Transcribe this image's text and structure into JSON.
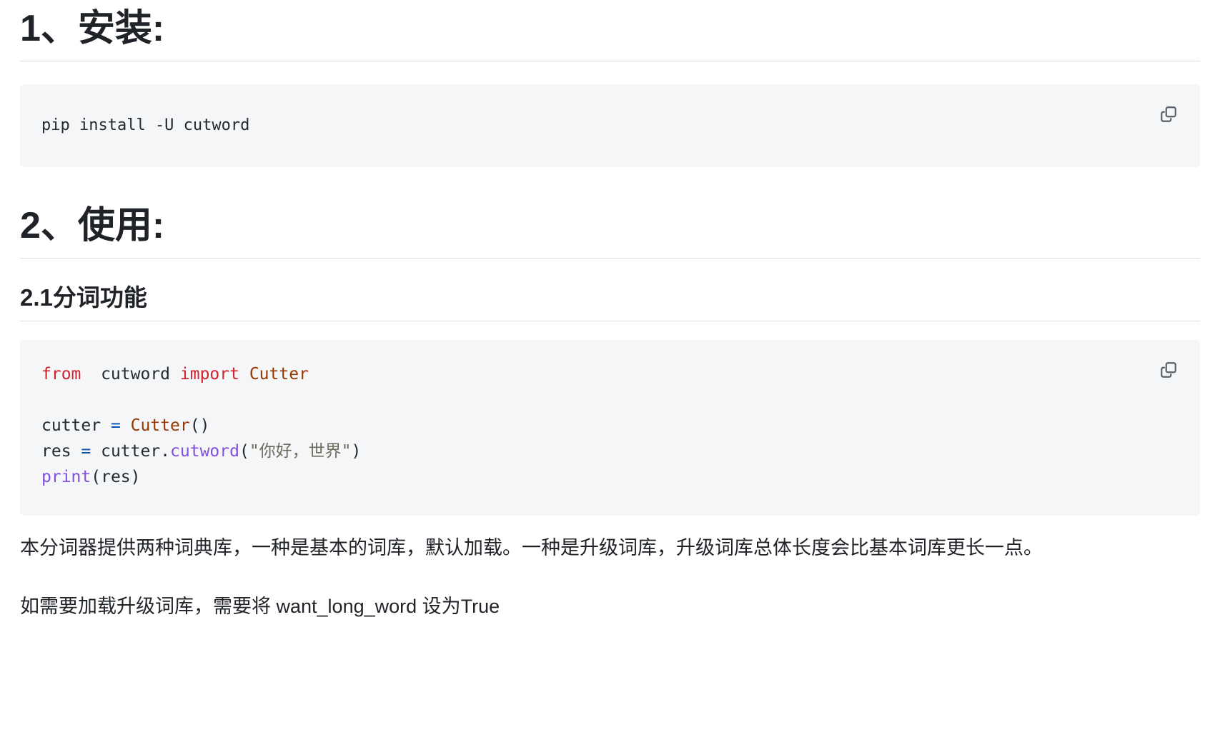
{
  "document": {
    "sections": [
      {
        "heading": "1、安装:",
        "code": {
          "language": "shell",
          "copy_icon": "copy-icon",
          "lines": [
            [
              {
                "t": "pip install -U cutword",
                "c": "tok-pln"
              }
            ]
          ]
        }
      },
      {
        "heading": "2、使用:",
        "subheading": "2.1分词功能",
        "code": {
          "language": "python",
          "copy_icon": "copy-icon",
          "lines": [
            [
              {
                "t": "from",
                "c": "tok-kw"
              },
              {
                "t": "  cutword ",
                "c": "tok-pln"
              },
              {
                "t": "import",
                "c": "tok-kw"
              },
              {
                "t": " ",
                "c": "tok-pln"
              },
              {
                "t": "Cutter",
                "c": "tok-cls"
              }
            ],
            [],
            [
              {
                "t": "cutter ",
                "c": "tok-pln"
              },
              {
                "t": "=",
                "c": "tok-op"
              },
              {
                "t": " ",
                "c": "tok-pln"
              },
              {
                "t": "Cutter",
                "c": "tok-cls"
              },
              {
                "t": "()",
                "c": "tok-pln"
              }
            ],
            [
              {
                "t": "res ",
                "c": "tok-pln"
              },
              {
                "t": "=",
                "c": "tok-op"
              },
              {
                "t": " cutter.",
                "c": "tok-pln"
              },
              {
                "t": "cutword",
                "c": "tok-fn"
              },
              {
                "t": "(",
                "c": "tok-pln"
              },
              {
                "t": "\"你好，世界\"",
                "c": "tok-str"
              },
              {
                "t": ")",
                "c": "tok-pln"
              }
            ],
            [
              {
                "t": "print",
                "c": "tok-fn"
              },
              {
                "t": "(res)",
                "c": "tok-pln"
              }
            ]
          ]
        }
      }
    ],
    "paragraphs": [
      "本分词器提供两种词典库，一种是基本的词库，默认加载。一种是升级词库，升级词库总体长度会比基本词库更长一点。",
      "如需要加载升级词库，需要将 want_long_word 设为True"
    ]
  },
  "colors": {
    "code_background": "#f5f6f8",
    "text": "#1f2328",
    "rule": "#d8dee4",
    "keyword": "#cf222e",
    "class": "#953800",
    "function": "#8250df",
    "operator": "#0550ae",
    "string": "#6e6a5e",
    "icon": "#57606a"
  }
}
